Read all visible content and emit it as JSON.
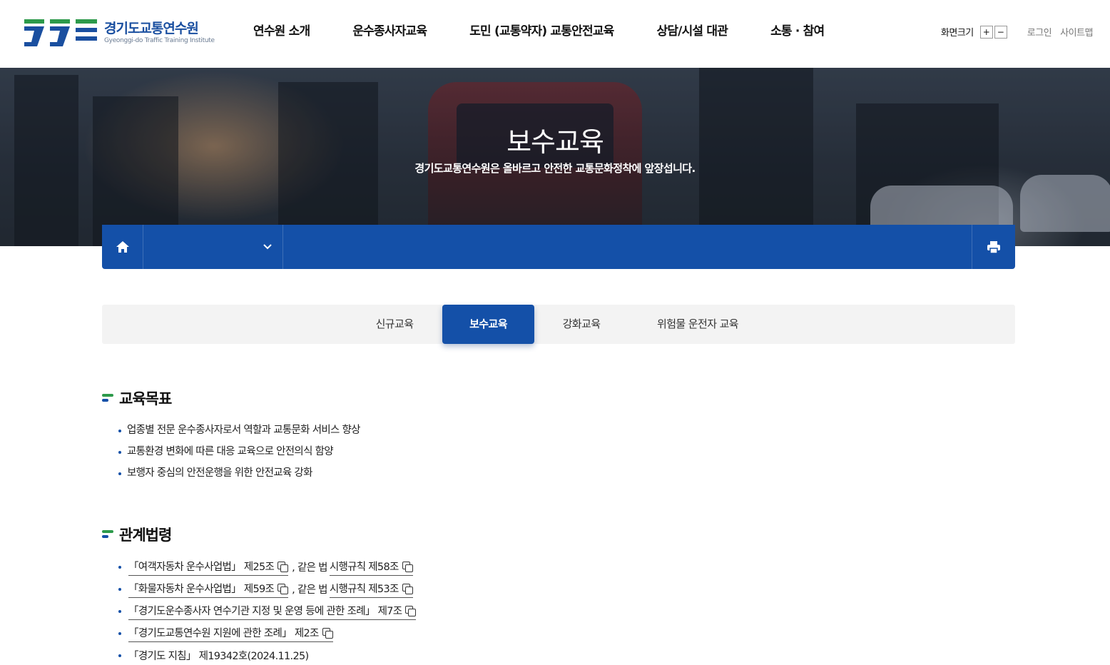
{
  "header": {
    "logo_ko": "경기도교통연수원",
    "logo_en": "Gyeonggi-do Traffic Training Institute",
    "nav": [
      "연수원 소개",
      "운수종사자교육",
      "도민 (교통약자) 교통안전교육",
      "상담/시설 대관",
      "소통 · 참여"
    ],
    "font_size_label": "화면크기",
    "font_plus": "+",
    "font_minus": "−",
    "login": "로그인",
    "sitemap": "사이트맵"
  },
  "hero": {
    "title": "보수교육",
    "subtitle": "경기도교통연수원은 올바르고 안전한 교통문화정착에 앞장섭니다."
  },
  "location_bar": {
    "home_icon": "home-icon",
    "select_icon": "chevron-down-icon",
    "print_icon": "print-icon"
  },
  "tabs": [
    {
      "label": "신규교육",
      "active": false
    },
    {
      "label": "보수교육",
      "active": true
    },
    {
      "label": "강화교육",
      "active": false
    },
    {
      "label": "위험물 운전자 교육",
      "active": false
    }
  ],
  "goals": {
    "title": "교육목표",
    "items": [
      "업종별 전문 운수종사자로서 역할과 교통문화 서비스 향상",
      "교통환경 변화에 따른 대응 교육으로 안전의식 함양",
      "보행자 중심의 안전운행을 위한 안전교육 강화"
    ]
  },
  "laws": {
    "title": "관계법령",
    "items": [
      {
        "law": "「여객자동차 운수사업법」 제25조",
        "joiner": ", 같은 법",
        "sub": "시행규칙 제58조"
      },
      {
        "law": "「화물자동차 운수사업법」 제59조",
        "joiner": ", 같은 법",
        "sub": "시행규칙 제53조"
      },
      {
        "law": "「경기도운수종사자 연수기관 지정 및 운영 등에 관한 조례」 제7조"
      },
      {
        "law": "「경기도교통연수원 지원에 관한 조례」 제2조"
      },
      {
        "law": "「경기도 지침」 제19342호(2024.11.25)",
        "plain": true
      }
    ]
  },
  "colors": {
    "primary": "#1450a8",
    "accent_green": "#2d9a4b"
  }
}
